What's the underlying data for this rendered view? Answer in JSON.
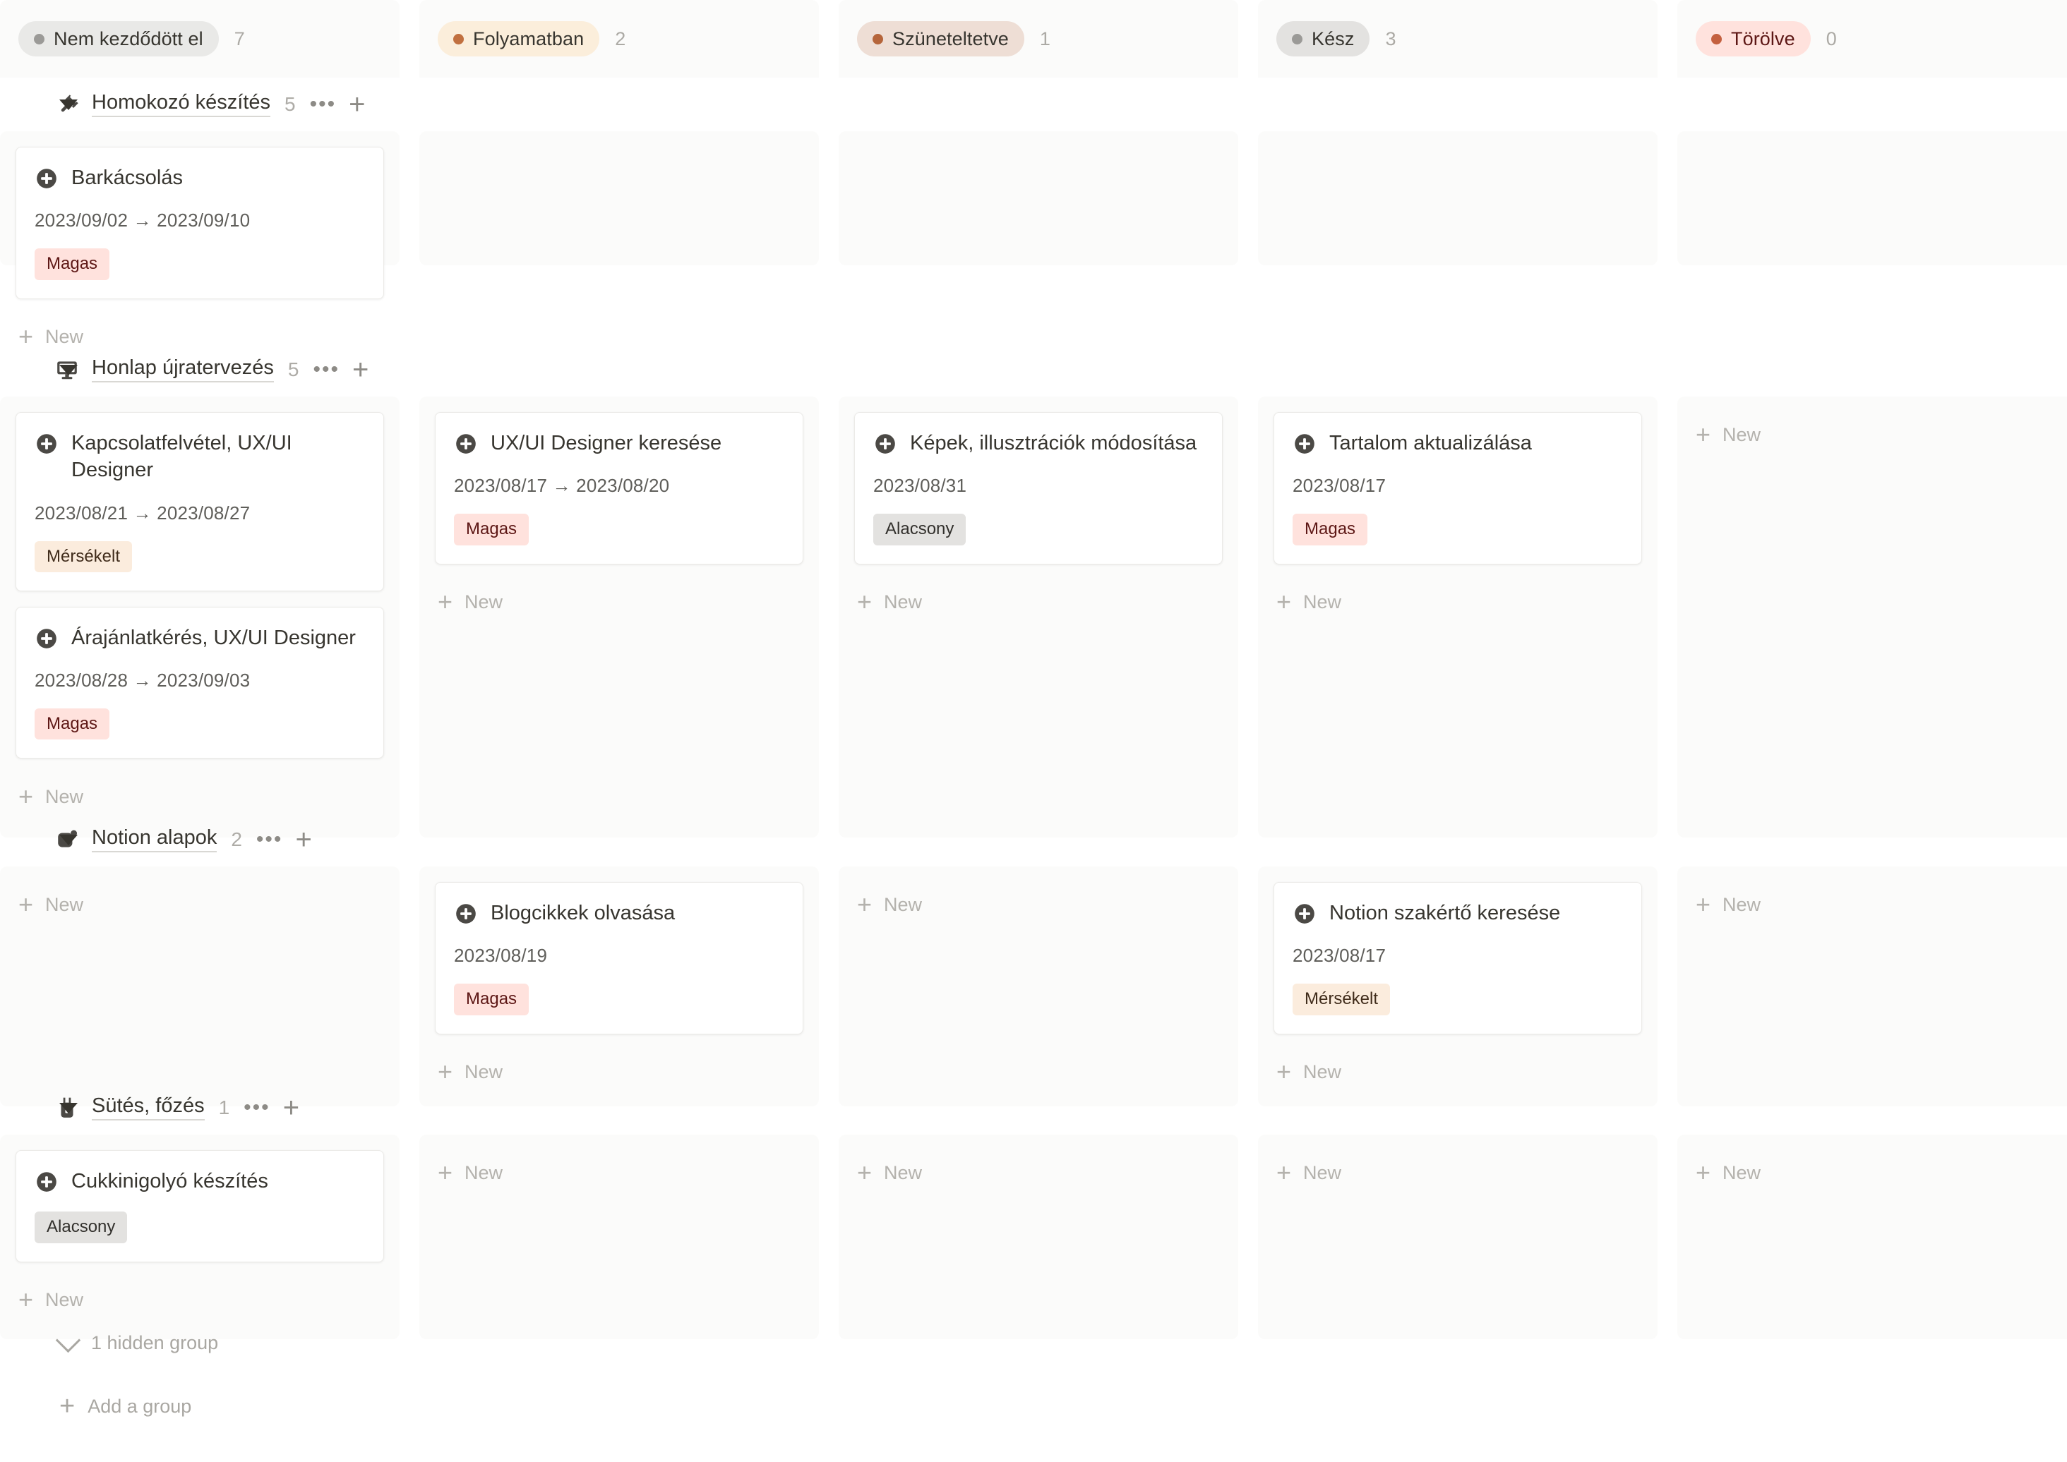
{
  "columns": [
    {
      "label": "Nem kezdődött el",
      "count": "7",
      "dot_color": "#9b9a97",
      "pill_bg": "#e9e9e7",
      "text_color": "#37352f"
    },
    {
      "label": "Folyamatban",
      "count": "2",
      "dot_color": "#c1703f",
      "pill_bg": "#fbeedb",
      "text_color": "#37352f"
    },
    {
      "label": "Szüneteltetve",
      "count": "1",
      "dot_color": "#b5653b",
      "pill_bg": "#eeded5",
      "text_color": "#37352f"
    },
    {
      "label": "Kész",
      "count": "3",
      "dot_color": "#9b9a97",
      "pill_bg": "#e3e2e0",
      "text_color": "#37352f"
    },
    {
      "label": "Törölve",
      "count": "0",
      "dot_color": "#c4603f",
      "pill_bg": "#ffe2dd",
      "text_color": "#5d1715"
    }
  ],
  "new_label": "New",
  "groups": [
    {
      "name": "Homokozó készítés",
      "count": "5",
      "icon": "hammer-icon",
      "cells": [
        {
          "cards": [
            {
              "title": "Barkácsolás",
              "date": "2023/09/02 → 2023/09/10",
              "tag": "Magas",
              "tag_bg": "#ffe2dd",
              "tag_color": "#5d1715"
            }
          ],
          "show_new": true
        },
        {
          "cards": [],
          "show_new": false
        },
        {
          "cards": [],
          "show_new": false
        },
        {
          "cards": [],
          "show_new": false
        },
        {
          "cards": [],
          "show_new": false
        }
      ]
    },
    {
      "name": "Honlap újratervezés",
      "count": "5",
      "icon": "desktop-computer-icon",
      "cells": [
        {
          "cards": [
            {
              "title": "Kapcsolatfelvétel, UX/UI Designer",
              "date": "2023/08/21 → 2023/08/27",
              "tag": "Mérsékelt",
              "tag_bg": "#fbecdd",
              "tag_color": "#402c1b"
            },
            {
              "title": "Árajánlatkérés, UX/UI Designer",
              "date": "2023/08/28 → 2023/09/03",
              "tag": "Magas",
              "tag_bg": "#ffe2dd",
              "tag_color": "#5d1715"
            }
          ],
          "show_new": true
        },
        {
          "cards": [
            {
              "title": "UX/UI Designer keresése",
              "date": "2023/08/17 → 2023/08/20",
              "tag": "Magas",
              "tag_bg": "#ffe2dd",
              "tag_color": "#5d1715"
            }
          ],
          "show_new": true
        },
        {
          "cards": [
            {
              "title": "Képek, illusztrációk módosítása",
              "date": "2023/08/31",
              "tag": "Alacsony",
              "tag_bg": "#e3e2e0",
              "tag_color": "#32302c"
            }
          ],
          "show_new": true
        },
        {
          "cards": [
            {
              "title": "Tartalom aktualizálása",
              "date": "2023/08/17",
              "tag": "Magas",
              "tag_bg": "#ffe2dd",
              "tag_color": "#5d1715"
            }
          ],
          "show_new": true
        },
        {
          "cards": [],
          "show_new": true
        }
      ]
    },
    {
      "name": "Notion alapok",
      "count": "2",
      "icon": "notion-logo-icon",
      "cells": [
        {
          "cards": [],
          "show_new": true
        },
        {
          "cards": [
            {
              "title": "Blogcikkek olvasása",
              "date": "2023/08/19",
              "tag": "Magas",
              "tag_bg": "#ffe2dd",
              "tag_color": "#5d1715"
            }
          ],
          "show_new": true
        },
        {
          "cards": [],
          "show_new": true
        },
        {
          "cards": [
            {
              "title": "Notion szakértő keresése",
              "date": "2023/08/17",
              "tag": "Mérsékelt",
              "tag_bg": "#fbecdd",
              "tag_color": "#402c1b"
            }
          ],
          "show_new": true
        },
        {
          "cards": [],
          "show_new": true
        }
      ]
    },
    {
      "name": "Sütés, főzés",
      "count": "1",
      "icon": "apron-icon",
      "cells": [
        {
          "cards": [
            {
              "title": "Cukkinigolyó készítés",
              "date": "",
              "tag": "Alacsony",
              "tag_bg": "#e3e2e0",
              "tag_color": "#32302c"
            }
          ],
          "show_new": true
        },
        {
          "cards": [],
          "show_new": true
        },
        {
          "cards": [],
          "show_new": true
        },
        {
          "cards": [],
          "show_new": true
        },
        {
          "cards": [],
          "show_new": true
        }
      ]
    }
  ],
  "footer": {
    "hidden_group_label": "1 hidden group",
    "add_group_label": "Add a group"
  }
}
